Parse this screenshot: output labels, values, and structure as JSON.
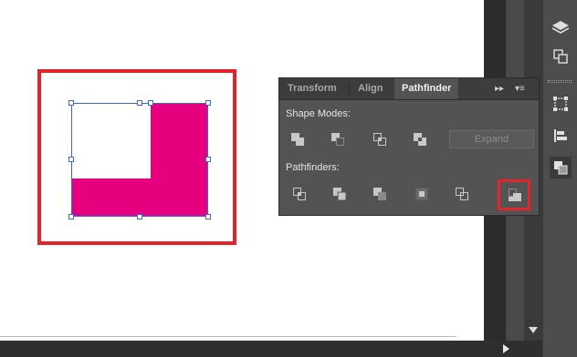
{
  "canvas": {
    "shape_color": "#e6007e",
    "highlight_color": "#e3242b",
    "selection_color": "#3a66d6"
  },
  "panel": {
    "tabs": [
      {
        "label": "Transform",
        "active": false
      },
      {
        "label": "Align",
        "active": false
      },
      {
        "label": "Pathfinder",
        "active": true
      }
    ],
    "collapse_glyph": "▸▸",
    "menu_glyph": "▾≡",
    "shape_modes_label": "Shape Modes:",
    "expand_label": "Expand",
    "pathfinders_label": "Pathfinders:",
    "shape_modes": [
      "unite-icon",
      "minus-front-icon",
      "intersect-icon",
      "exclude-icon"
    ],
    "pathfinders": [
      "divide-icon",
      "trim-icon",
      "merge-icon",
      "crop-icon",
      "outline-icon",
      "minus-back-icon"
    ],
    "highlighted_pathfinder": "minus-back-icon"
  },
  "right_dock": {
    "icons": [
      "layers-icon",
      "artboards-icon",
      "transform-icon",
      "align-icon",
      "pathfinder-icon"
    ],
    "active": "pathfinder-icon"
  }
}
